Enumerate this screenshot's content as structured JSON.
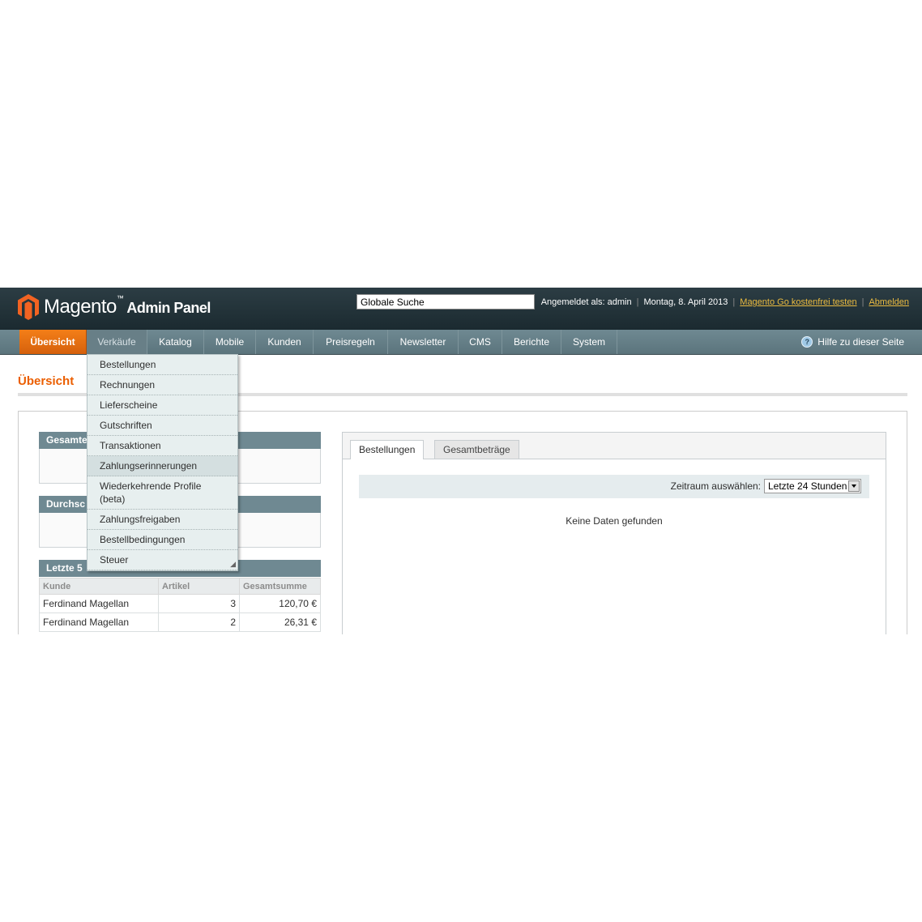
{
  "header": {
    "logo_main": "Magento",
    "logo_tm": "™",
    "logo_sub": "Admin Panel",
    "search_value": "Globale Suche",
    "logged_in": "Angemeldet als: admin",
    "date": "Montag, 8. April 2013",
    "trial_link": "Magento Go kostenfrei testen",
    "logout": "Abmelden",
    "sep": "|"
  },
  "nav": {
    "items": [
      "Übersicht",
      "Verkäufe",
      "Katalog",
      "Mobile",
      "Kunden",
      "Preisregeln",
      "Newsletter",
      "CMS",
      "Berichte",
      "System"
    ],
    "help": "Hilfe zu dieser Seite",
    "help_icon_glyph": "?"
  },
  "dropdown": {
    "items": [
      "Bestellungen",
      "Rechnungen",
      "Lieferscheine",
      "Gutschriften",
      "Transaktionen",
      "Zahlungserinnerungen",
      "Wiederkehrende Profile (beta)",
      "Zahlungsfreigaben",
      "Bestellbedingungen",
      "Steuer"
    ]
  },
  "page_title": "Übersicht",
  "left": {
    "box1_title": "Gesamte",
    "box2_title": "Durchsc",
    "box3_title": "Letzte 5",
    "table": {
      "headers": [
        "Kunde",
        "Artikel",
        "Gesamtsumme"
      ],
      "rows": [
        [
          "Ferdinand Magellan",
          "3",
          "120,70 €"
        ],
        [
          "Ferdinand Magellan",
          "2",
          "26,31 €"
        ]
      ]
    }
  },
  "right": {
    "tabs": [
      "Bestellungen",
      "Gesamtbeträge"
    ],
    "period_label": "Zeitraum auswählen:",
    "period_value": "Letzte 24 Stunden",
    "no_data": "Keine Daten gefunden"
  },
  "colors": {
    "accent": "#eb5e00",
    "header_bg": "#24353b",
    "nav_bg": "#6f8992",
    "link": "#ebbb40"
  }
}
